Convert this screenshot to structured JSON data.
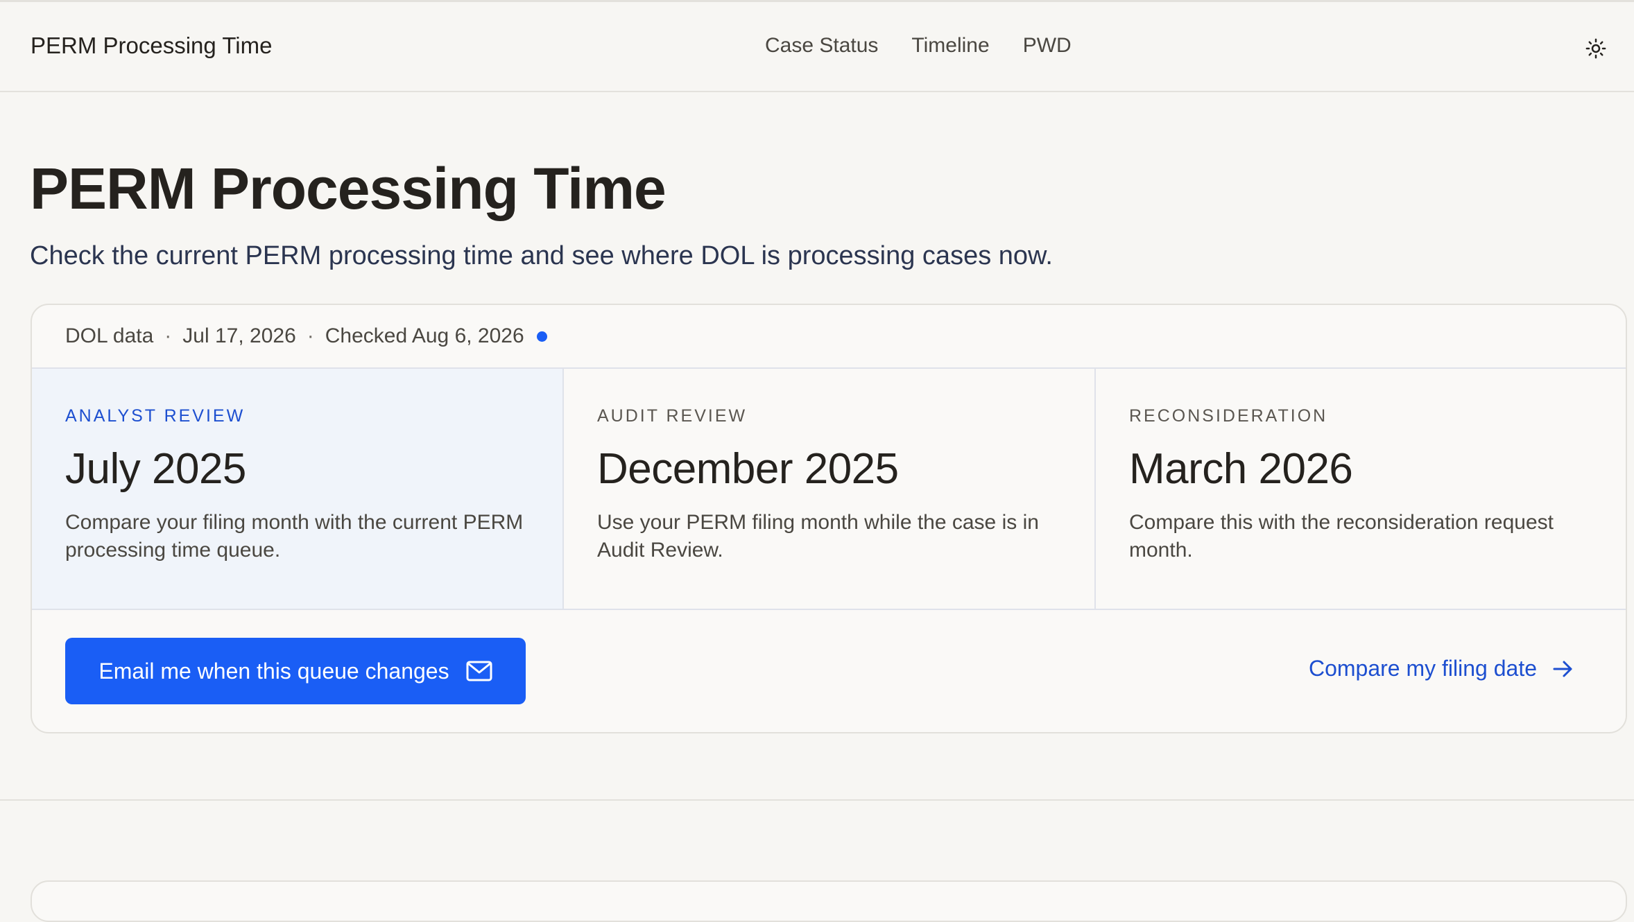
{
  "header": {
    "brand": "PERM Processing Time",
    "nav": [
      "Case Status",
      "Timeline",
      "PWD"
    ],
    "theme_toggle_icon": "sun-icon"
  },
  "hero": {
    "title": "PERM Processing Time",
    "subtitle": "Check the current PERM processing time and see where DOL is processing cases now."
  },
  "card": {
    "meta": {
      "source": "DOL data",
      "separator": "·",
      "data_date": "Jul 17, 2026",
      "checked": "Checked Aug 6, 2026"
    },
    "queues": [
      {
        "label": "ANALYST REVIEW",
        "value": "July 2025",
        "description": "Compare your filing month with the current PERM processing time queue."
      },
      {
        "label": "AUDIT REVIEW",
        "value": "December 2025",
        "description": "Use your PERM filing month while the case is in Audit Review."
      },
      {
        "label": "RECONSIDERATION",
        "value": "March 2026",
        "description": "Compare this with the reconsideration request month."
      }
    ],
    "email_button": "Email me when this queue changes",
    "compare_link": "Compare my filing date"
  },
  "colors": {
    "accent": "#1a5ef5",
    "link": "#1d4fd0",
    "background": "#f7f6f3",
    "active_panel": "#f0f4fa"
  }
}
